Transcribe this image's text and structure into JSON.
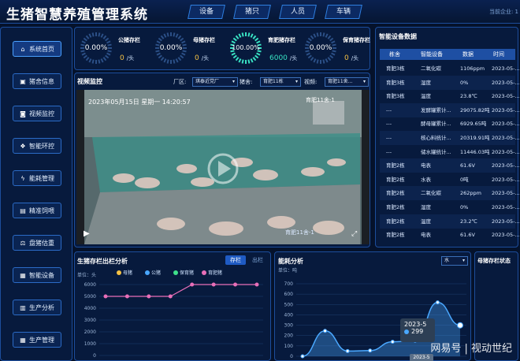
{
  "app": {
    "title": "生猪智慧养殖管理系统",
    "enterprise_label": "当前企业: 1"
  },
  "topnav": [
    "设备",
    "猪只",
    "人员",
    "车辆"
  ],
  "sidebar": [
    {
      "label": "系统首页",
      "icon": "home-icon",
      "active": true
    },
    {
      "label": "猪舍信息",
      "icon": "barn-icon"
    },
    {
      "label": "视频监控",
      "icon": "camera-icon"
    },
    {
      "label": "智能环控",
      "icon": "environment-icon"
    },
    {
      "label": "能耗管理",
      "icon": "energy-icon"
    },
    {
      "label": "精准饲喂",
      "icon": "feed-icon"
    },
    {
      "label": "盘猪估重",
      "icon": "scale-icon"
    },
    {
      "label": "智能设备",
      "icon": "device-icon"
    },
    {
      "label": "生产分析",
      "icon": "document-icon"
    },
    {
      "label": "生产管理",
      "icon": "grid-icon"
    }
  ],
  "stats": [
    {
      "ring": "0.00%",
      "label": "公猪存栏",
      "value": "0",
      "unit": "/头",
      "highlight": false
    },
    {
      "ring": "0.00%",
      "label": "母猪存栏",
      "value": "0",
      "unit": "/头",
      "highlight": false
    },
    {
      "ring": "100.00%",
      "label": "育肥猪存栏",
      "value": "6000",
      "unit": "/头",
      "highlight": true
    },
    {
      "ring": "0.00%",
      "label": "保育猪存栏",
      "value": "0",
      "unit": "/头",
      "highlight": false
    }
  ],
  "video": {
    "title": "视频监控",
    "factory_label": "厂区:",
    "factory_value": "琪泰近党厂",
    "barn_label": "猪舍:",
    "barn_value": "育肥11栋",
    "cam_label": "视频:",
    "cam_value": "育肥11舍...",
    "timestamp": "2023年05月15日  星期一  14:20:57",
    "overlay_name": "育肥11舍-1"
  },
  "devices": {
    "title": "智能设备数据",
    "headers": [
      "栋舍",
      "智能设备",
      "数据",
      "时间"
    ],
    "rows": [
      [
        "育肥3栋",
        "二氧化碳",
        "1106ppm",
        "2023-05-..."
      ],
      [
        "育肥3栋",
        "湿度",
        "0%",
        "2023-05-..."
      ],
      [
        "育肥3栋",
        "温度",
        "23.8℃",
        "2023-05-..."
      ],
      [
        "---",
        "发酵罐累计...",
        "29075.82吨",
        "2023-05-..."
      ],
      [
        "---",
        "酵母罐累计...",
        "6929.65吨",
        "2023-05-..."
      ],
      [
        "---",
        "核心料统计...",
        "20319.91吨",
        "2023-05-..."
      ],
      [
        "---",
        "储水罐统计...",
        "11446.03吨",
        "2023-05-..."
      ],
      [
        "育肥2栋",
        "电表",
        "61.6V",
        "2023-05-..."
      ],
      [
        "育肥2栋",
        "水表",
        "0吨",
        "2023-05-..."
      ],
      [
        "育肥2栋",
        "二氧化碳",
        "262ppm",
        "2023-05-..."
      ],
      [
        "育肥2栋",
        "湿度",
        "0%",
        "2023-05-..."
      ],
      [
        "育肥2栋",
        "温度",
        "23.2℃",
        "2023-05-..."
      ],
      [
        "育肥2栋",
        "电表",
        "61.6V",
        "2023-05-..."
      ]
    ]
  },
  "stock_chart": {
    "title": "生猪存栏出栏分析",
    "tabs": [
      "存栏",
      "出栏"
    ],
    "unit_label": "单位：头",
    "legend": [
      "母猪",
      "公猪",
      "保育猪",
      "育肥猪"
    ],
    "legend_colors": [
      "#f5c244",
      "#4aa8ff",
      "#3ee08a",
      "#e86fb8"
    ]
  },
  "energy_chart": {
    "title": "能耗分析",
    "unit_label": "单位：吨",
    "select_value": "水",
    "tooltip_date": "2023-5",
    "tooltip_value": "299",
    "axis_tag": "2023-5"
  },
  "sow_panel": {
    "title": "母猪存栏状态"
  },
  "watermark": "网易号 | 视动世纪",
  "chart_data": [
    {
      "type": "line",
      "title": "生猪存栏出栏分析",
      "ylabel": "单位：头",
      "ylim": [
        0,
        6000
      ],
      "yticks": [
        0,
        1000,
        2000,
        3000,
        4000,
        5000,
        6000
      ],
      "series": [
        {
          "name": "育肥猪",
          "color": "#e86fb8",
          "values": [
            5000,
            5000,
            5000,
            5000,
            6000,
            6000,
            6000,
            6000
          ]
        }
      ]
    },
    {
      "type": "area",
      "title": "能耗分析",
      "ylabel": "单位：吨",
      "ylim": [
        0,
        700
      ],
      "yticks": [
        0,
        100,
        200,
        300,
        400,
        500,
        600,
        700
      ],
      "series": [
        {
          "name": "水",
          "color": "#4aa8ff",
          "values": [
            0,
            245,
            50,
            55,
            140,
            150,
            520,
            299
          ]
        }
      ]
    }
  ]
}
